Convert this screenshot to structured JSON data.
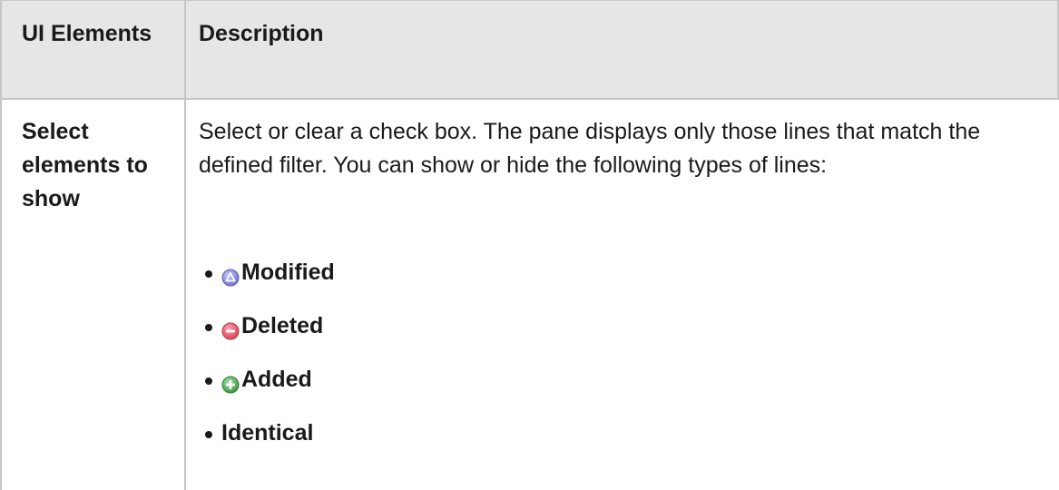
{
  "table": {
    "headers": {
      "ui_elements": "UI Elements",
      "description": "Description"
    },
    "rows": [
      {
        "ui_element": "Select elements to show",
        "description": "Select or clear a check box. The pane displays only those lines that match the defined filter. You can show or hide the following types of lines:",
        "items": [
          {
            "label": "Modified",
            "icon": "modified-icon",
            "color": "#8f8fe0"
          },
          {
            "label": "Deleted",
            "icon": "deleted-icon",
            "color": "#e05a6a"
          },
          {
            "label": "Added",
            "icon": "added-icon",
            "color": "#4caf50"
          },
          {
            "label": "Identical",
            "icon": "",
            "color": ""
          }
        ]
      }
    ]
  }
}
